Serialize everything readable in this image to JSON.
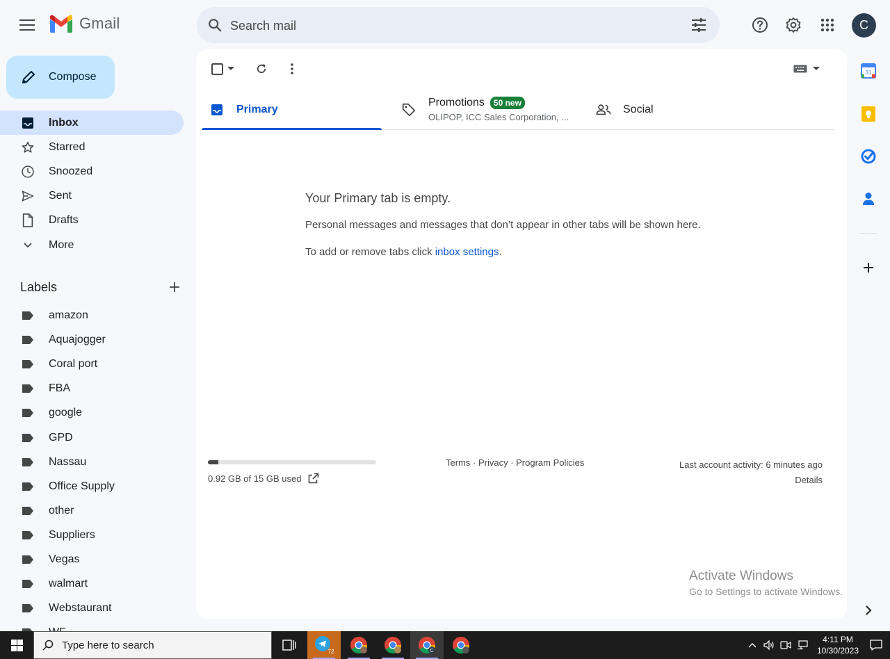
{
  "header": {
    "app_name": "Gmail",
    "search_placeholder": "Search mail",
    "avatar_initial": "C"
  },
  "compose": {
    "label": "Compose"
  },
  "nav": {
    "items": [
      {
        "label": "Inbox",
        "icon": "inbox-icon",
        "active": true
      },
      {
        "label": "Starred",
        "icon": "star-icon"
      },
      {
        "label": "Snoozed",
        "icon": "clock-icon"
      },
      {
        "label": "Sent",
        "icon": "send-icon"
      },
      {
        "label": "Drafts",
        "icon": "draft-icon"
      },
      {
        "label": "More",
        "icon": "chevron-down-icon"
      }
    ]
  },
  "labels": {
    "title": "Labels",
    "items": [
      "amazon",
      "Aquajogger",
      "Coral port",
      "FBA",
      "google",
      "GPD",
      "Nassau",
      "Office Supply",
      "other",
      "Suppliers",
      "Vegas",
      "walmart",
      "Webstaurant",
      "WF"
    ]
  },
  "tabs": {
    "primary": {
      "label": "Primary"
    },
    "promotions": {
      "label": "Promotions",
      "badge": "50 new",
      "snippet": "OLIPOP, ICC Sales Corporation, ..."
    },
    "social": {
      "label": "Social"
    }
  },
  "empty": {
    "title": "Your Primary tab is empty.",
    "description": "Personal messages and messages that don’t appear in other tabs will be shown here.",
    "hint_prefix": "To add or remove tabs click ",
    "hint_link": "inbox settings",
    "hint_suffix": "."
  },
  "footer": {
    "storage_text": "0.92 GB of 15 GB used",
    "storage_fraction": 0.061,
    "terms": "Terms",
    "privacy": "Privacy",
    "program_policies": "Program Policies",
    "separator": " · ",
    "last_activity": "Last account activity: 6 minutes ago",
    "details": "Details"
  },
  "watermark": {
    "title": "Activate Windows",
    "subtitle": "Go to Settings to activate Windows."
  },
  "side_panel": {
    "calendar_day": "31"
  },
  "taskbar": {
    "search_placeholder": "Type here to search",
    "telegram_badge": "72",
    "time": "4:11 PM",
    "date": "10/30/2023"
  },
  "colors": {
    "accent": "#0b57d0",
    "compose_bg": "#c2e7ff",
    "active_nav_bg": "#d3e3fd",
    "badge_green": "#188038",
    "page_bg": "#f6f8fc"
  }
}
